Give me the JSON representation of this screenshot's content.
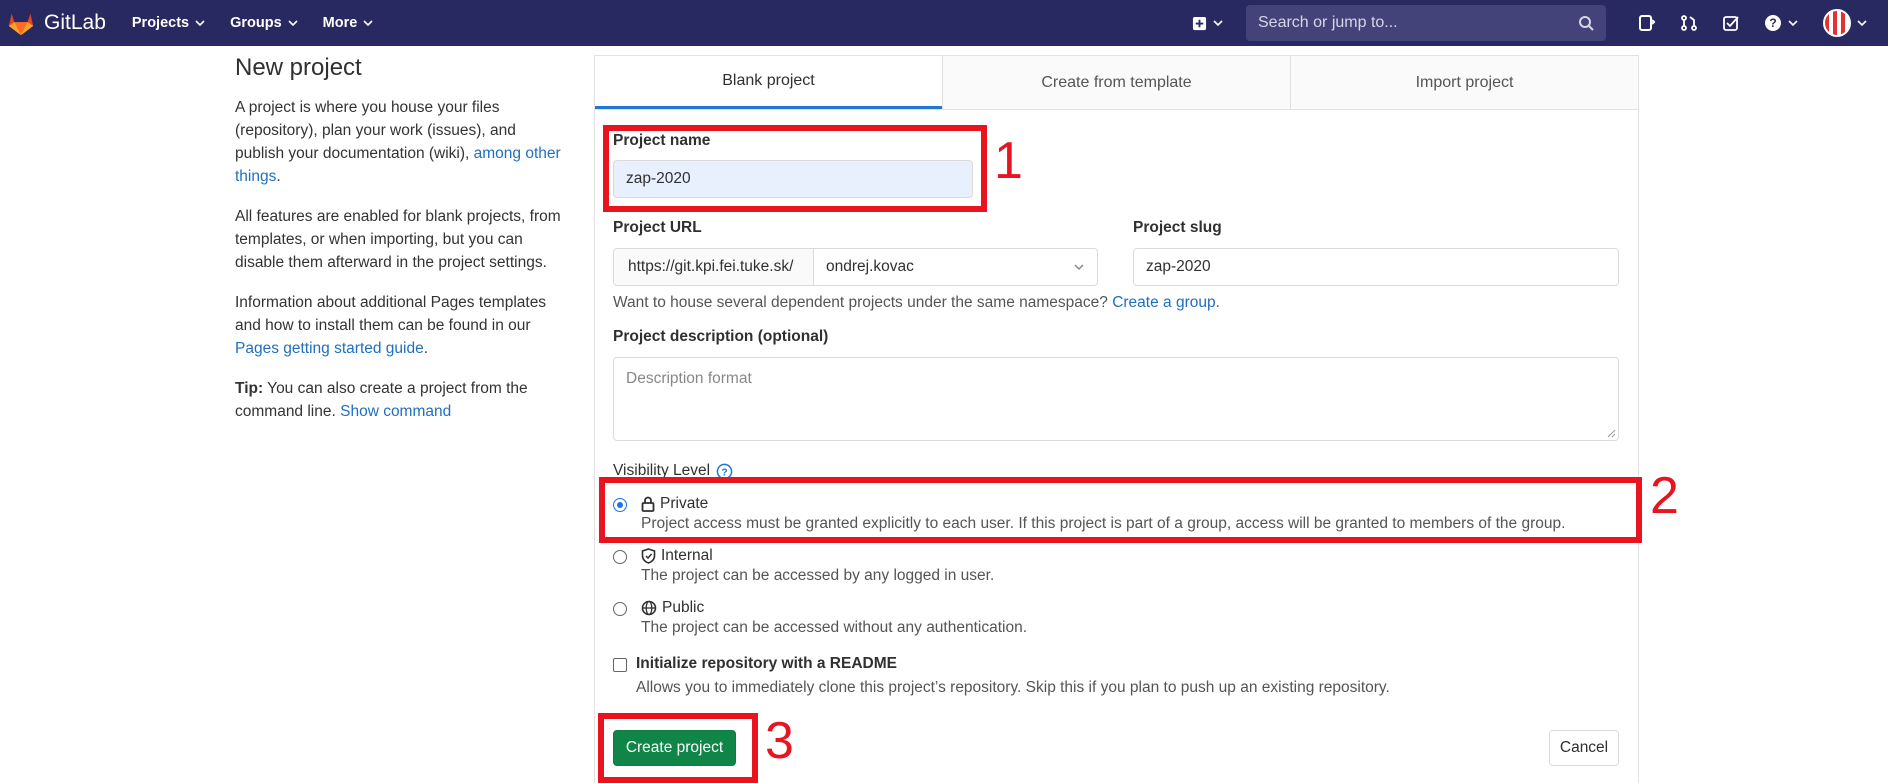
{
  "navbar": {
    "brand": "GitLab",
    "menu": [
      {
        "label": "Projects"
      },
      {
        "label": "Groups"
      },
      {
        "label": "More"
      }
    ],
    "search_placeholder": "Search or jump to..."
  },
  "info": {
    "title": "New project",
    "p1_text": "A project is where you house your files (repository), plan your work (issues), and publish your documentation (wiki), ",
    "p1_link": "among other things",
    "p1_end": ".",
    "p2": "All features are enabled for blank projects, from templates, or when importing, but you can disable them afterward in the project settings.",
    "p3_text": "Information about additional Pages templates and how to install them can be found in our ",
    "p3_link": "Pages getting started guide",
    "p3_end": ".",
    "tip_bold": "Tip:",
    "tip_text": " You can also create a project from the command line. ",
    "tip_link": "Show command"
  },
  "tabs": [
    {
      "label": "Blank project",
      "active": true
    },
    {
      "label": "Create from template"
    },
    {
      "label": "Import project"
    }
  ],
  "form": {
    "name_label": "Project name",
    "name_value": "zap-2020",
    "url_label": "Project URL",
    "url_prefix": "https://git.kpi.fei.tuke.sk/",
    "namespace": "ondrej.kovac",
    "slug_label": "Project slug",
    "slug_value": "zap-2020",
    "group_help": "Want to house several dependent projects under the same namespace? ",
    "group_link": "Create a group",
    "group_end": ".",
    "desc_label": "Project description (optional)",
    "desc_placeholder": "Description format",
    "visibility_label": "Visibility Level",
    "visibility": [
      {
        "title": "Private",
        "desc": "Project access must be granted explicitly to each user. If this project is part of a group, access will be granted to members of the group.",
        "checked": true
      },
      {
        "title": "Internal",
        "desc": "The project can be accessed by any logged in user."
      },
      {
        "title": "Public",
        "desc": "The project can be accessed without any authentication."
      }
    ],
    "readme_label": "Initialize repository with a README",
    "readme_desc": "Allows you to immediately clone this project’s repository. Skip this if you plan to push up an existing repository.",
    "create_label": "Create project",
    "cancel_label": "Cancel"
  },
  "annotations": [
    "1",
    "2",
    "3"
  ],
  "colors": {
    "navbar": "#292961",
    "accent": "#1f78d1",
    "create_button": "#108548",
    "annotation": "#e8141f"
  }
}
